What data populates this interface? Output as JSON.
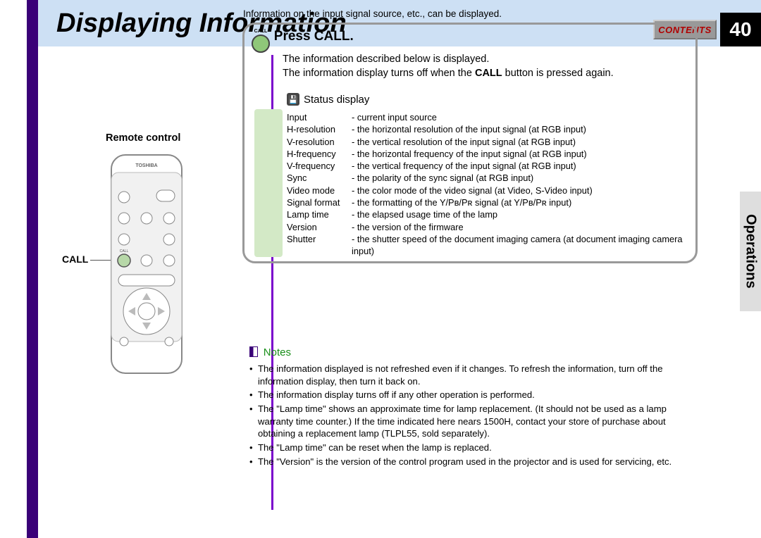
{
  "header": {
    "title": "Displaying Information",
    "contents_label": "CONTENTS",
    "page_number": "40",
    "side_tab": "Operations"
  },
  "remote": {
    "label": "Remote control",
    "call_indicator": "CALL",
    "brand": "TOSHIBA"
  },
  "intro": "Information on the input signal source, etc., can be displayed.",
  "call_box": {
    "button_label": "CALL",
    "heading": "Press CALL.",
    "desc_line1": "The information described below is displayed.",
    "desc_line2a": "The information display turns off when the ",
    "desc_bold": "CALL",
    "desc_line2b": " button is pressed again.",
    "status_title": "Status display",
    "params": [
      {
        "k": "Input",
        "v": "current input source"
      },
      {
        "k": "H-resolution",
        "v": "the horizontal resolution of the input signal (at RGB input)"
      },
      {
        "k": "V-resolution",
        "v": "the vertical resolution of the input signal (at RGB input)"
      },
      {
        "k": "H-frequency",
        "v": "the horizontal frequency of the input signal (at RGB input)"
      },
      {
        "k": "V-frequency",
        "v": "the vertical frequency of the input signal (at RGB input)"
      },
      {
        "k": "Sync",
        "v": "the polarity of the sync signal (at RGB input)"
      },
      {
        "k": "Video mode",
        "v": "the color mode of the video signal (at Video, S-Video input)"
      },
      {
        "k": "Signal format",
        "v": "the formatting of the Y/Pʙ/Pʀ signal (at Y/Pʙ/Pʀ input)"
      },
      {
        "k": "Lamp time",
        "v": "the elapsed usage time of the lamp"
      },
      {
        "k": "Version",
        "v": "the version of the firmware"
      },
      {
        "k": "Shutter",
        "v": "the shutter speed of the document imaging camera (at document imaging camera input)"
      }
    ]
  },
  "notes": {
    "heading": "Notes",
    "items": [
      "The information displayed is not refreshed even if it changes. To refresh the information, turn off the information display, then turn it back on.",
      "The information display turns off if any other operation is performed.",
      "The \"Lamp time\" shows an approximate time for lamp replacement. (It should not be used as a lamp warranty time counter.) If the time indicated here nears 1500H, contact your store of purchase about obtaining a replacement lamp (TLPL55, sold separately).",
      "The \"Lamp time\" can be reset when the lamp is replaced.",
      "The \"Version\" is the version of the control program used in the projector and is used for servicing, etc."
    ]
  }
}
